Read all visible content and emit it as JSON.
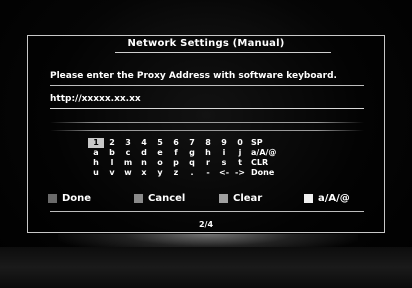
{
  "dialog": {
    "title": "Network Settings (Manual)",
    "instruction": "Please enter the Proxy Address with software keyboard.",
    "input_value": "http://xxxxx.xx.xx",
    "page_indicator": "2/4"
  },
  "keyboard": {
    "selected_key": "1",
    "rows": [
      [
        "1",
        "2",
        "3",
        "4",
        "5",
        "6",
        "7",
        "8",
        "9",
        "0",
        "SP"
      ],
      [
        "a",
        "b",
        "c",
        "d",
        "e",
        "f",
        "g",
        "h",
        "i",
        "j",
        "a/A/@"
      ],
      [
        "h",
        "l",
        "m",
        "n",
        "o",
        "p",
        "q",
        "r",
        "s",
        "t",
        "CLR"
      ],
      [
        "u",
        "v",
        "w",
        "x",
        "y",
        "z",
        ".",
        "-",
        "<-",
        "->",
        "Done"
      ]
    ]
  },
  "footer": {
    "done": {
      "label": "Done",
      "color": "#6a6a6a"
    },
    "cancel": {
      "label": "Cancel",
      "color": "#8a8a8a"
    },
    "clear": {
      "label": "Clear",
      "color": "#a0a0a0"
    },
    "mode": {
      "label": "a/A/@",
      "color": "#f0f0f0"
    }
  }
}
